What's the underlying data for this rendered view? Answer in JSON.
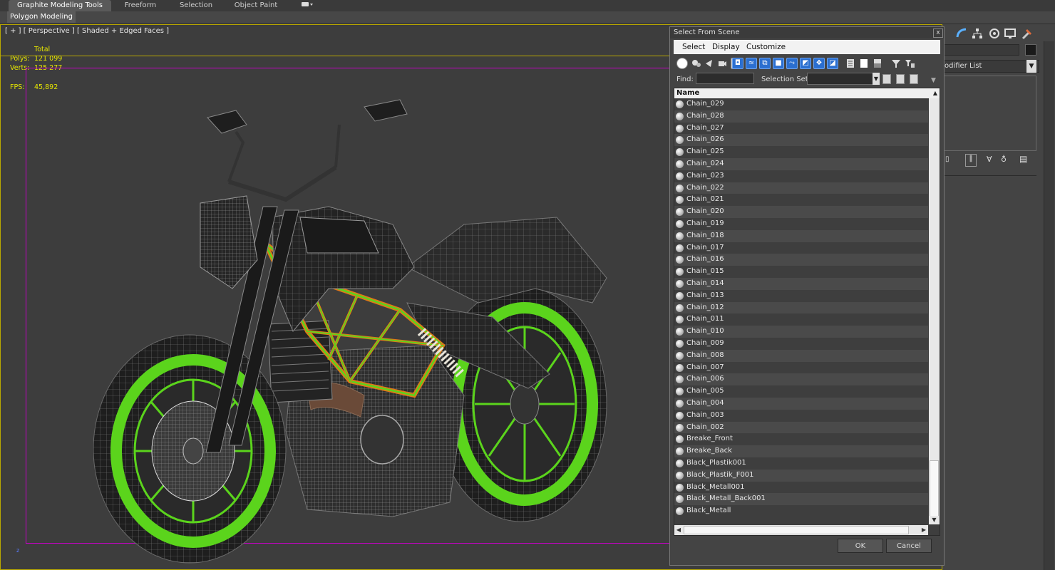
{
  "ribbon": {
    "tabs": [
      {
        "label": "Graphite Modeling Tools",
        "active": true
      },
      {
        "label": "Freeform",
        "active": false
      },
      {
        "label": "Selection",
        "active": false
      },
      {
        "label": "Object Paint",
        "active": false
      }
    ],
    "sub_tab": "Polygon Modeling"
  },
  "viewport": {
    "label": "[ + ] [ Perspective ] [ Shaded + Edged Faces ]",
    "stats": {
      "total_label": "Total",
      "polys_label": "Polys:",
      "polys_value": "121 099",
      "verts_label": "Verts:",
      "verts_value": "125 277",
      "fps_label": "FPS:",
      "fps_value": "45,892"
    },
    "axis_label": "z"
  },
  "command_panel": {
    "modifier_list": "odifier List"
  },
  "dialog": {
    "title": "Select From Scene",
    "close_glyph": "x",
    "menu": [
      "Select",
      "Display",
      "Customize"
    ],
    "find_label": "Find:",
    "find_value": "",
    "selection_set_label": "Selection Set:",
    "column_header": "Name",
    "items": [
      "Chain_029",
      "Chain_028",
      "Chain_027",
      "Chain_026",
      "Chain_025",
      "Chain_024",
      "Chain_023",
      "Chain_022",
      "Chain_021",
      "Chain_020",
      "Chain_019",
      "Chain_018",
      "Chain_017",
      "Chain_016",
      "Chain_015",
      "Chain_014",
      "Chain_013",
      "Chain_012",
      "Chain_011",
      "Chain_010",
      "Chain_009",
      "Chain_008",
      "Chain_007",
      "Chain_006",
      "Chain_005",
      "Chain_004",
      "Chain_003",
      "Chain_002",
      "Breake_Front",
      "Breake_Back",
      "Black_Plastik001",
      "Black_Plastik_F001",
      "Black_Metall001",
      "Black_Metall_Back001",
      "Black_Metall"
    ],
    "ok_label": "OK",
    "cancel_label": "Cancel"
  },
  "colors": {
    "viewport_border": "#b9a800",
    "safe_frame": "#c800c8",
    "stat_text": "#e6e600",
    "wire_green": "#5bd41c",
    "frame_orange": "#e07818",
    "toolbar_blue": "#2b6fd0"
  }
}
